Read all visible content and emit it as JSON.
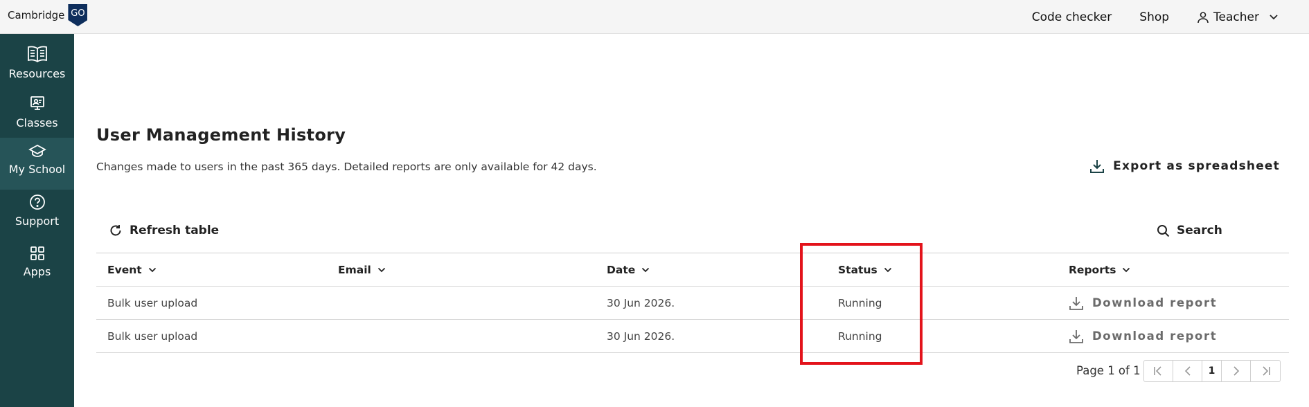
{
  "brand": {
    "name": "Cambridge",
    "badge": "GO"
  },
  "topnav": {
    "code_checker": "Code checker",
    "shop": "Shop",
    "user": "Teacher"
  },
  "sidebar": {
    "items": [
      {
        "label": "Resources",
        "icon": "book-icon"
      },
      {
        "label": "Classes",
        "icon": "classroom-icon"
      },
      {
        "label": "My School",
        "icon": "graduation-cap-icon",
        "active": true
      },
      {
        "label": "Support",
        "icon": "help-icon"
      },
      {
        "label": "Apps",
        "icon": "apps-grid-icon"
      }
    ]
  },
  "main": {
    "title": "User Management History",
    "description": "Changes made to users in the past 365 days. Detailed reports are only available for 42 days.",
    "export_label": "Export as spreadsheet",
    "refresh_label": "Refresh table",
    "search_label": "Search"
  },
  "table": {
    "columns": [
      "Event",
      "Email",
      "Date",
      "Status",
      "Reports"
    ],
    "rows": [
      {
        "event": "Bulk user upload",
        "email": "",
        "date": "30 Jun 2026.",
        "status": "Running",
        "report": "Download report"
      },
      {
        "event": "Bulk user upload",
        "email": "",
        "date": "30 Jun 2026.",
        "status": "Running",
        "report": "Download report"
      }
    ]
  },
  "pagination": {
    "label": "Page 1 of 1",
    "current": "1"
  },
  "colors": {
    "sidebar": "#1b4346",
    "sidebar_active": "#265458",
    "highlight": "#e3131b",
    "brand_shield": "#0e2e5c"
  }
}
